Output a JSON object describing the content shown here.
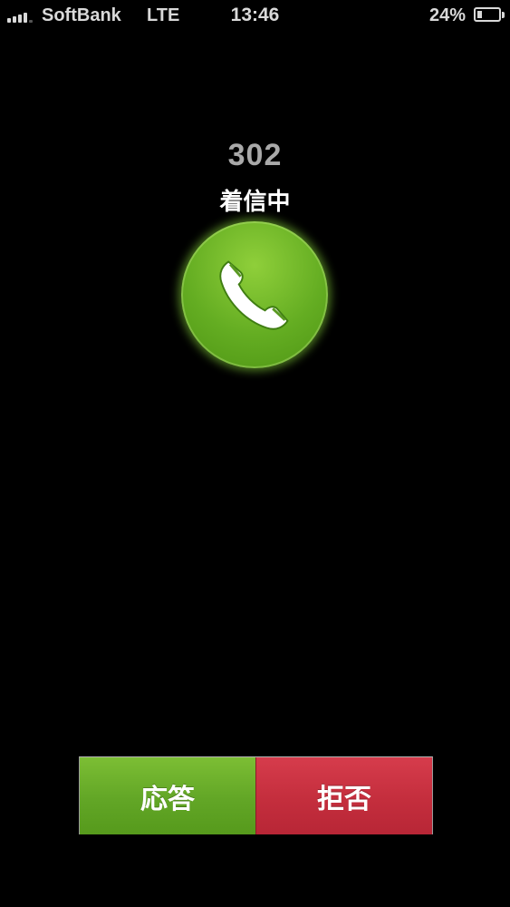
{
  "status_bar": {
    "carrier": "SoftBank",
    "network": "LTE",
    "time": "13:46",
    "battery_percent_label": "24%",
    "battery_level": 0.24,
    "signal_bars": 5,
    "signal_active_bars": 4,
    "signal_icon": "cellular-signal-icon",
    "battery_icon": "battery-icon"
  },
  "call": {
    "number": "302",
    "status": "着信中",
    "icon": "phone-handset-icon"
  },
  "actions": {
    "answer_label": "応答",
    "decline_label": "拒否"
  },
  "colors": {
    "answer": "#62a626",
    "decline": "#c42e3d",
    "circle": "#64ad22"
  }
}
